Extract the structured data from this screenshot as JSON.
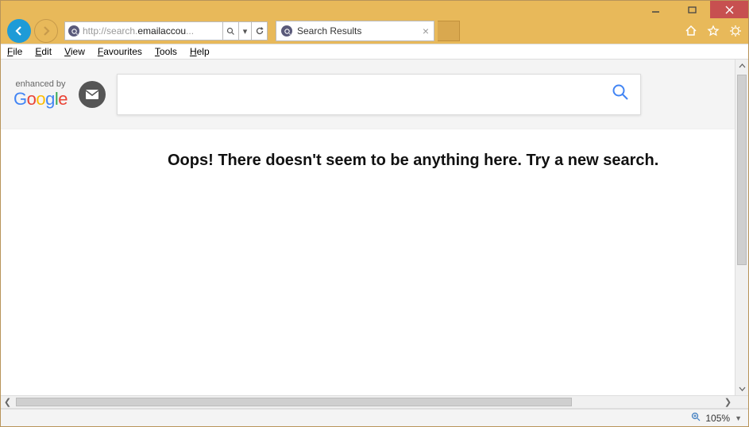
{
  "window": {
    "url_prefix": "http://search.",
    "url_host": "emailaccou",
    "url_suffix": "...",
    "tab_title": "Search Results"
  },
  "menu": {
    "items": [
      {
        "u": "F",
        "rest": "ile"
      },
      {
        "u": "E",
        "rest": "dit"
      },
      {
        "u": "V",
        "rest": "iew"
      },
      {
        "u": "F",
        "rest": "avourites"
      },
      {
        "u": "T",
        "rest": "ools"
      },
      {
        "u": "H",
        "rest": "elp"
      }
    ]
  },
  "page": {
    "enhanced_label": "enhanced by",
    "google_letters": [
      "G",
      "o",
      "o",
      "g",
      "l",
      "e"
    ],
    "search_value": "",
    "search_placeholder": "",
    "message": "Oops! There doesn't seem to be anything here. Try a new search."
  },
  "status": {
    "zoom": "105%"
  }
}
